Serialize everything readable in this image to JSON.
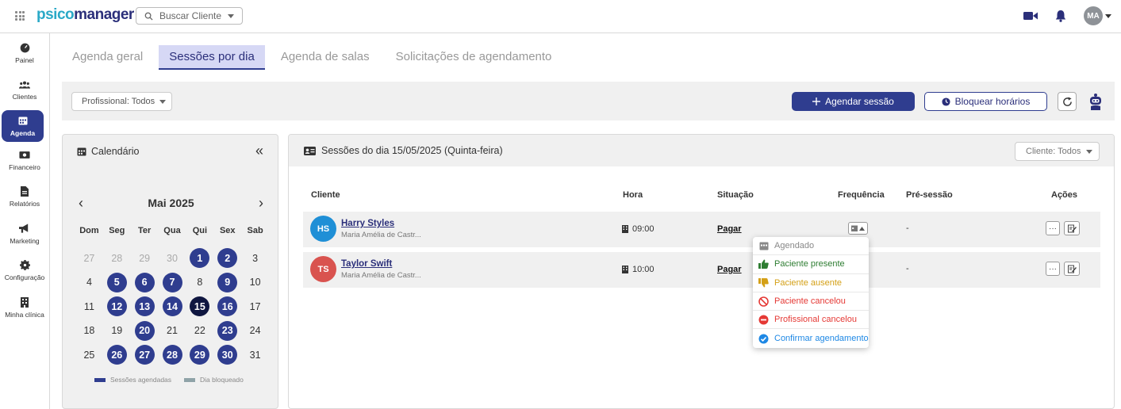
{
  "topbar": {
    "logo_prefix": "psico",
    "logo_suffix": "manager",
    "search_placeholder": "Buscar Cliente",
    "user_initials": "MA",
    "icons": [
      "apps-grid-icon",
      "search-icon",
      "video-icon",
      "bell-icon"
    ]
  },
  "sidebar": {
    "items": [
      {
        "label": "Painel",
        "icon": "dashboard-icon",
        "active": false
      },
      {
        "label": "Clientes",
        "icon": "users-icon",
        "active": false
      },
      {
        "label": "Agenda",
        "icon": "calendar-icon",
        "active": true
      },
      {
        "label": "Financeiro",
        "icon": "money-icon",
        "active": false
      },
      {
        "label": "Relatórios",
        "icon": "report-icon",
        "active": false
      },
      {
        "label": "Marketing",
        "icon": "megaphone-icon",
        "active": false
      },
      {
        "label": "Configuração",
        "icon": "gear-icon",
        "active": false
      },
      {
        "label": "Minha clínica",
        "icon": "building-icon",
        "active": false
      }
    ]
  },
  "tabs": [
    {
      "label": "Agenda geral",
      "active": false
    },
    {
      "label": "Sessões por dia",
      "active": true
    },
    {
      "label": "Agenda de salas",
      "active": false
    },
    {
      "label": "Solicitações de agendamento",
      "active": false
    }
  ],
  "toolbar": {
    "professional_filter": "Profissional: Todos",
    "schedule_button": "Agendar sessão",
    "block_button": "Bloquear horários"
  },
  "calendar": {
    "title": "Calendário",
    "month_label": "Mai 2025",
    "weekdays": [
      "Dom",
      "Seg",
      "Ter",
      "Qua",
      "Qui",
      "Sex",
      "Sab"
    ],
    "days": [
      {
        "d": "27",
        "s": "muted"
      },
      {
        "d": "28",
        "s": "muted"
      },
      {
        "d": "29",
        "s": "muted"
      },
      {
        "d": "30",
        "s": "muted"
      },
      {
        "d": "1",
        "s": "sched"
      },
      {
        "d": "2",
        "s": "sched"
      },
      {
        "d": "3",
        "s": ""
      },
      {
        "d": "4",
        "s": ""
      },
      {
        "d": "5",
        "s": "sched"
      },
      {
        "d": "6",
        "s": "sched"
      },
      {
        "d": "7",
        "s": "sched"
      },
      {
        "d": "8",
        "s": ""
      },
      {
        "d": "9",
        "s": "sched"
      },
      {
        "d": "10",
        "s": ""
      },
      {
        "d": "11",
        "s": ""
      },
      {
        "d": "12",
        "s": "sched"
      },
      {
        "d": "13",
        "s": "sched"
      },
      {
        "d": "14",
        "s": "sched"
      },
      {
        "d": "15",
        "s": "today"
      },
      {
        "d": "16",
        "s": "sched"
      },
      {
        "d": "17",
        "s": ""
      },
      {
        "d": "18",
        "s": ""
      },
      {
        "d": "19",
        "s": ""
      },
      {
        "d": "20",
        "s": "sched"
      },
      {
        "d": "21",
        "s": ""
      },
      {
        "d": "22",
        "s": ""
      },
      {
        "d": "23",
        "s": "sched"
      },
      {
        "d": "24",
        "s": ""
      },
      {
        "d": "25",
        "s": ""
      },
      {
        "d": "26",
        "s": "sched"
      },
      {
        "d": "27",
        "s": "sched"
      },
      {
        "d": "28",
        "s": "sched"
      },
      {
        "d": "29",
        "s": "sched"
      },
      {
        "d": "30",
        "s": "sched"
      },
      {
        "d": "31",
        "s": ""
      }
    ],
    "legend": {
      "scheduled": "Sessões agendadas",
      "blocked": "Dia bloqueado"
    },
    "colors": {
      "scheduled": "#2f3d8f",
      "today": "#0f1640",
      "blocked": "#8fa3a8"
    }
  },
  "sessions": {
    "title": "Sessões do dia 15/05/2025 (Quinta-feira)",
    "client_filter": "Cliente: Todos",
    "columns": {
      "client": "Cliente",
      "time": "Hora",
      "status": "Situação",
      "frequency": "Frequência",
      "pre_session": "Pré-sessão",
      "actions": "Ações"
    },
    "rows": [
      {
        "initials": "HS",
        "name": "Harry Styles",
        "professional": "Maria Amélia de Castr...",
        "time": "09:00",
        "status": "Pagar",
        "pre": "-",
        "avatar_color": "#1f8fd6"
      },
      {
        "initials": "TS",
        "name": "Taylor Swift",
        "professional": "Maria Amélia de Castr...",
        "time": "10:00",
        "status": "Pagar",
        "pre": "-",
        "avatar_color": "#d9534f"
      }
    ]
  },
  "frequency_menu": {
    "items": [
      {
        "label": "Agendado",
        "color": "#888888",
        "icon": "calendar-icon"
      },
      {
        "label": "Paciente presente",
        "color": "#2e7d32",
        "icon": "thumbs-up-icon"
      },
      {
        "label": "Paciente ausente",
        "color": "#d4a017",
        "icon": "thumbs-down-icon"
      },
      {
        "label": "Paciente cancelou",
        "color": "#e53935",
        "icon": "ban-icon"
      },
      {
        "label": "Profissional cancelou",
        "color": "#e53935",
        "icon": "minus-circle-icon"
      },
      {
        "label": "Confirmar agendamento",
        "color": "#1e88e5",
        "icon": "check-circle-icon"
      }
    ]
  }
}
